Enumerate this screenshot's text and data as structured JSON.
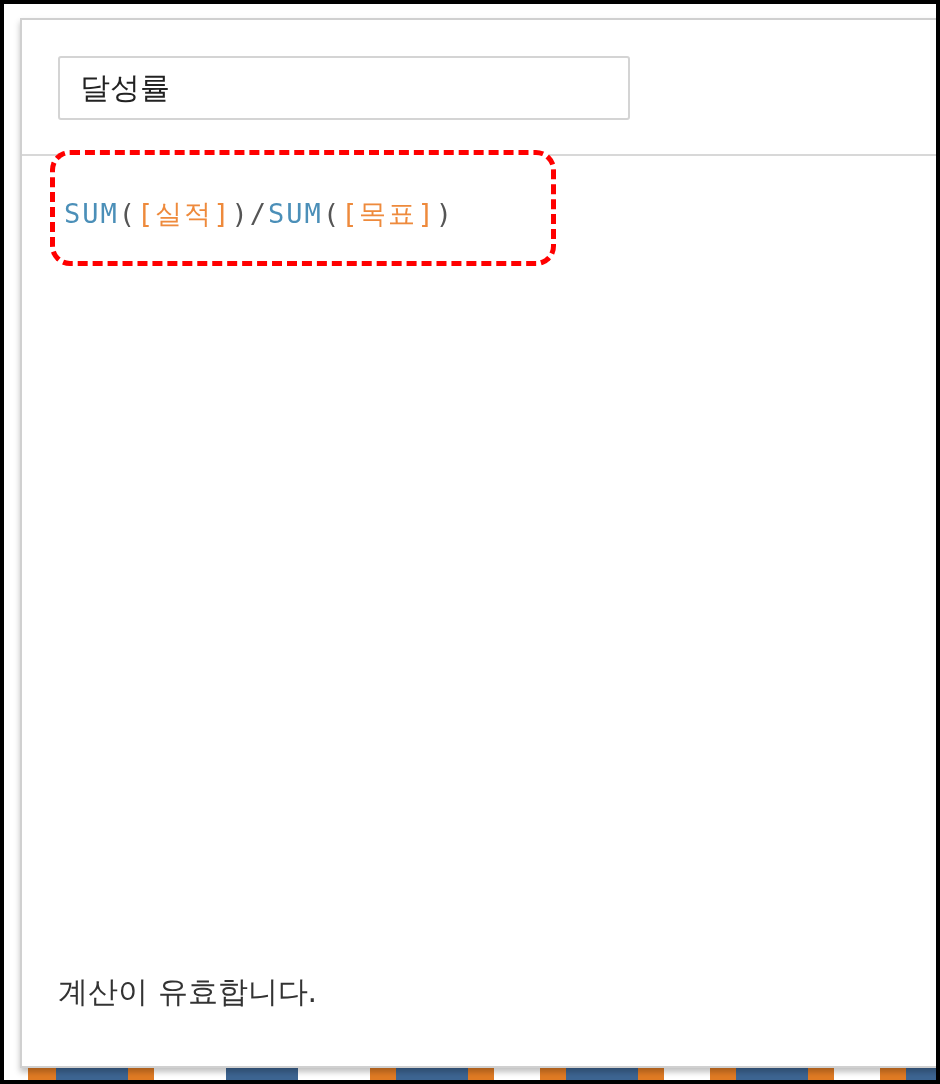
{
  "calculation_name": {
    "value": "달성률"
  },
  "formula": [
    {
      "kind": "function",
      "text": "SUM"
    },
    {
      "kind": "paren",
      "text": "("
    },
    {
      "kind": "field",
      "text": "[실적]"
    },
    {
      "kind": "paren",
      "text": ")"
    },
    {
      "kind": "operator",
      "text": "/"
    },
    {
      "kind": "function",
      "text": "SUM"
    },
    {
      "kind": "paren",
      "text": "("
    },
    {
      "kind": "field",
      "text": "[목표]"
    },
    {
      "kind": "paren",
      "text": ")"
    }
  ],
  "status": "계산이 유효합니다."
}
